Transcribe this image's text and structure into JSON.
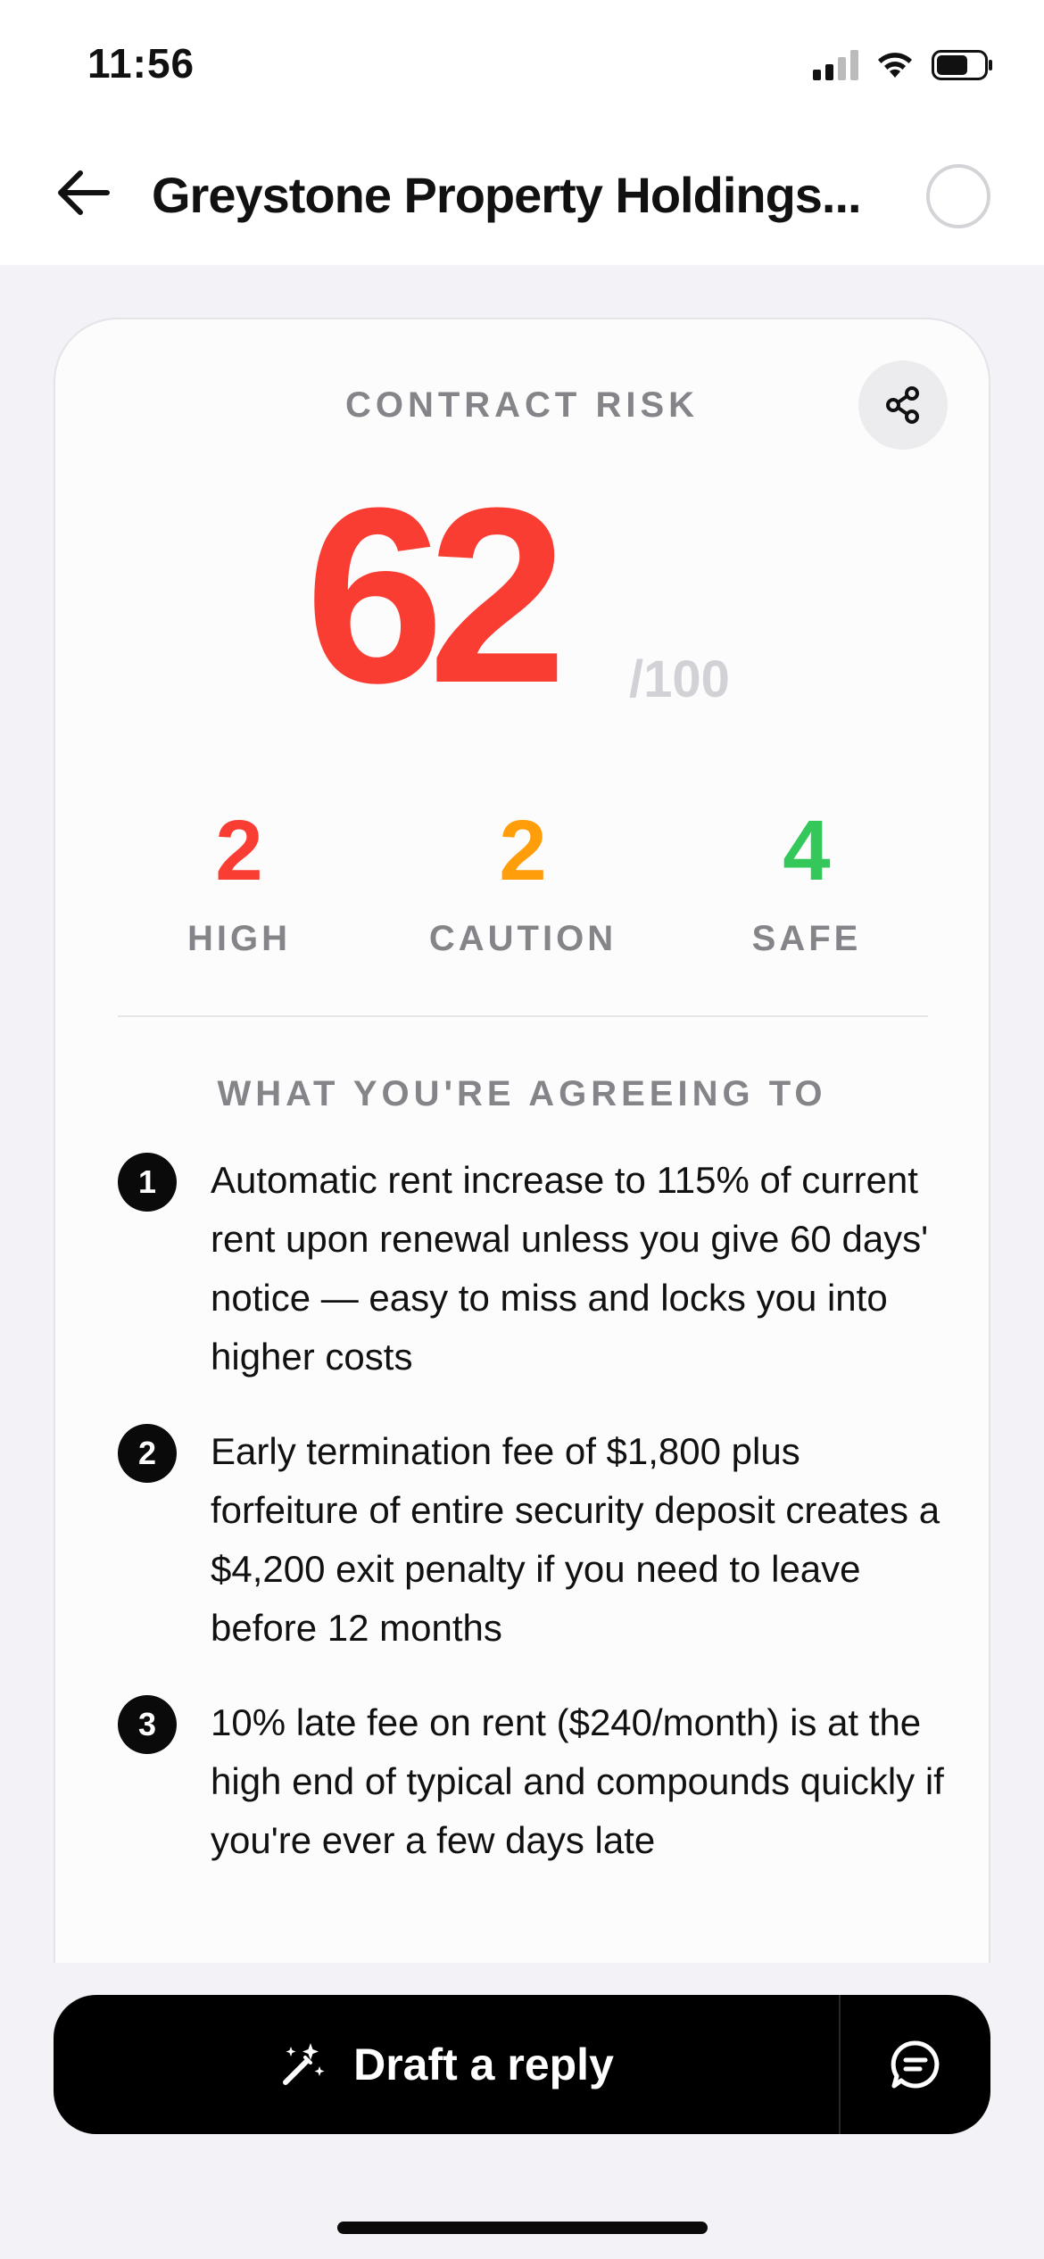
{
  "status_bar": {
    "time": "11:56"
  },
  "nav": {
    "title": "Greystone Property Holdings..."
  },
  "card": {
    "label": "CONTRACT RISK",
    "score": "62",
    "score_max": "/100",
    "risk_score": 62,
    "stats": [
      {
        "value": "2",
        "label": "HIGH",
        "color": "#fa3d32"
      },
      {
        "value": "2",
        "label": "CAUTION",
        "color": "#ff9d0a"
      },
      {
        "value": "4",
        "label": "SAFE",
        "color": "#34c759"
      }
    ],
    "section_title": "WHAT YOU'RE AGREEING TO",
    "items": [
      {
        "number": "1",
        "text": "Automatic rent increase to 115% of current rent upon renewal unless you give 60 days' notice — easy to miss and locks you into higher costs"
      },
      {
        "number": "2",
        "text": "Early termination fee of $1,800 plus forfeiture of entire security deposit creates a $4,200 exit penalty if you need to leave before 12 months"
      },
      {
        "number": "3",
        "text": "10% late fee on rent ($240/month) is at the high end of typical and compounds quickly if you're ever a few days late"
      }
    ]
  },
  "bottom_bar": {
    "draft_label": "Draft a reply"
  },
  "icons": {
    "back": "arrow-left-icon",
    "share": "share-icon",
    "draft": "magic-wand-icon",
    "chat": "chat-bubble-icon"
  },
  "colors": {
    "accent": "#fa3d32",
    "high": "#fa3d32",
    "caution": "#ff9d0a",
    "safe": "#34c759"
  }
}
